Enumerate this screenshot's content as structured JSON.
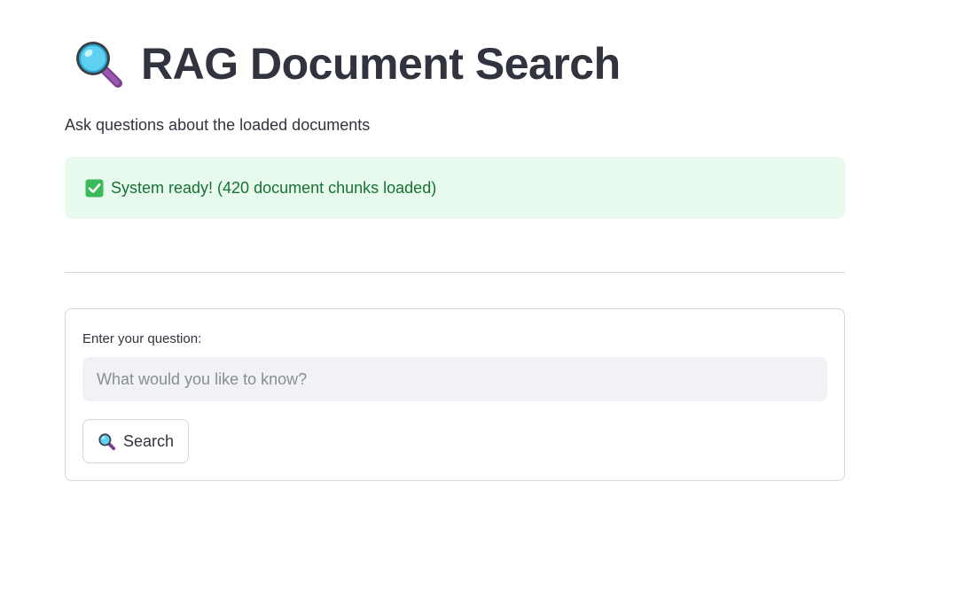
{
  "header": {
    "icon": "magnifying-glass-icon",
    "title": "RAG Document Search",
    "subtitle": "Ask questions about the loaded documents"
  },
  "status": {
    "icon": "check-mark-icon",
    "message": "System ready! (420 document chunks loaded)",
    "color": "#177233",
    "background": "#e8f9ee"
  },
  "form": {
    "question_label": "Enter your question:",
    "question_placeholder": "What would you like to know?",
    "question_value": "",
    "search_button": {
      "icon": "magnifying-glass-icon",
      "label": "Search"
    }
  }
}
